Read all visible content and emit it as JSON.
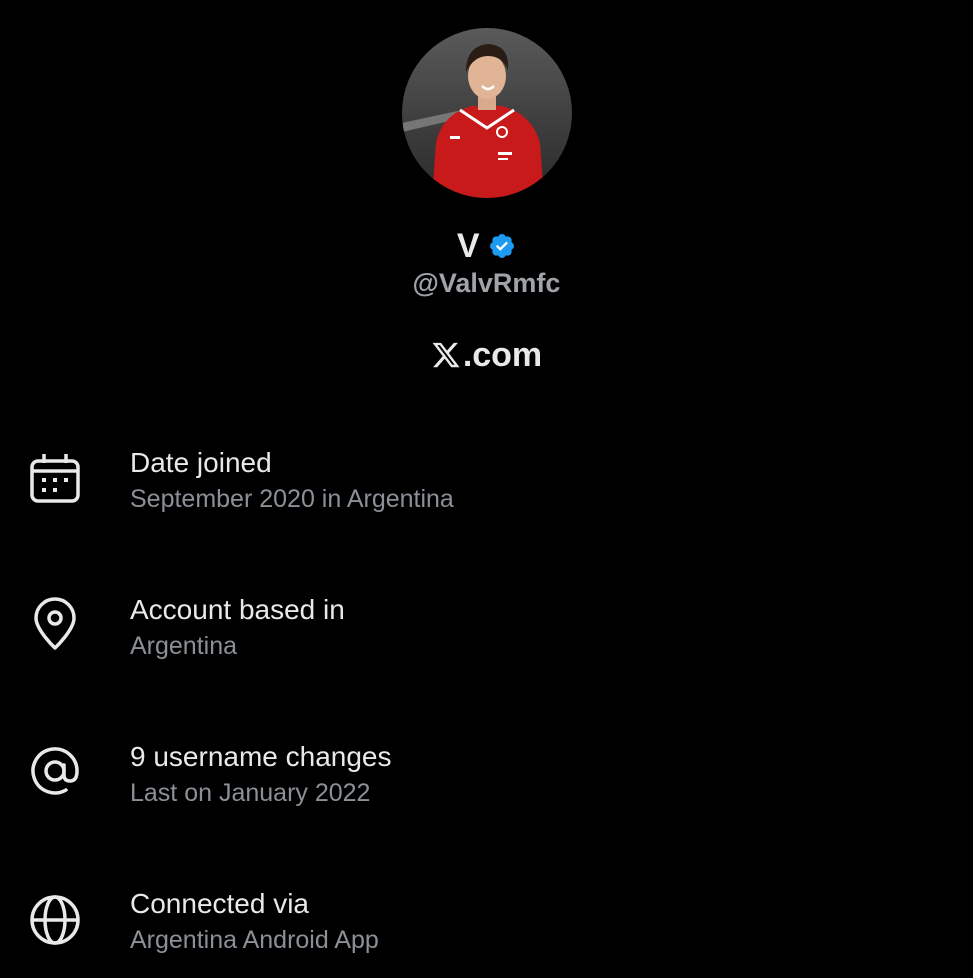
{
  "profile": {
    "display_name": "V",
    "handle": "@ValvRmfc",
    "verified": true,
    "verified_color": "#1d9bf0",
    "avatar_icon": "profile-photo"
  },
  "source": {
    "logo_icon": "x-logo-icon",
    "text": ".com"
  },
  "info": [
    {
      "icon": "calendar-icon",
      "label": "Date joined",
      "value": "September 2020 in Argentina"
    },
    {
      "icon": "location-pin-icon",
      "label": "Account based in",
      "value": "Argentina"
    },
    {
      "icon": "at-sign-icon",
      "label": "9 username changes",
      "value": "Last on January 2022"
    },
    {
      "icon": "globe-icon",
      "label": "Connected via",
      "value": "Argentina Android App"
    }
  ],
  "colors": {
    "background": "#000000",
    "primary_text": "#e7e9ea",
    "secondary_text": "#8b9096"
  }
}
